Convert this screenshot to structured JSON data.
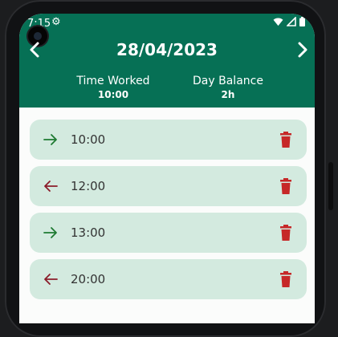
{
  "status_bar": {
    "time": "7:15"
  },
  "header": {
    "date": "28/04/2023",
    "time_worked_label": "Time Worked",
    "time_worked_value": "10:00",
    "day_balance_label": "Day Balance",
    "day_balance_value": "2h"
  },
  "entries": [
    {
      "direction": "in",
      "time": "10:00"
    },
    {
      "direction": "out",
      "time": "12:00"
    },
    {
      "direction": "in",
      "time": "13:00"
    },
    {
      "direction": "out",
      "time": "20:00"
    }
  ],
  "colors": {
    "header_bg": "#067055",
    "entry_bg": "#d3eadf",
    "arrow_in": "#1e7a32",
    "arrow_out": "#8b1c2a",
    "delete": "#c62828"
  }
}
